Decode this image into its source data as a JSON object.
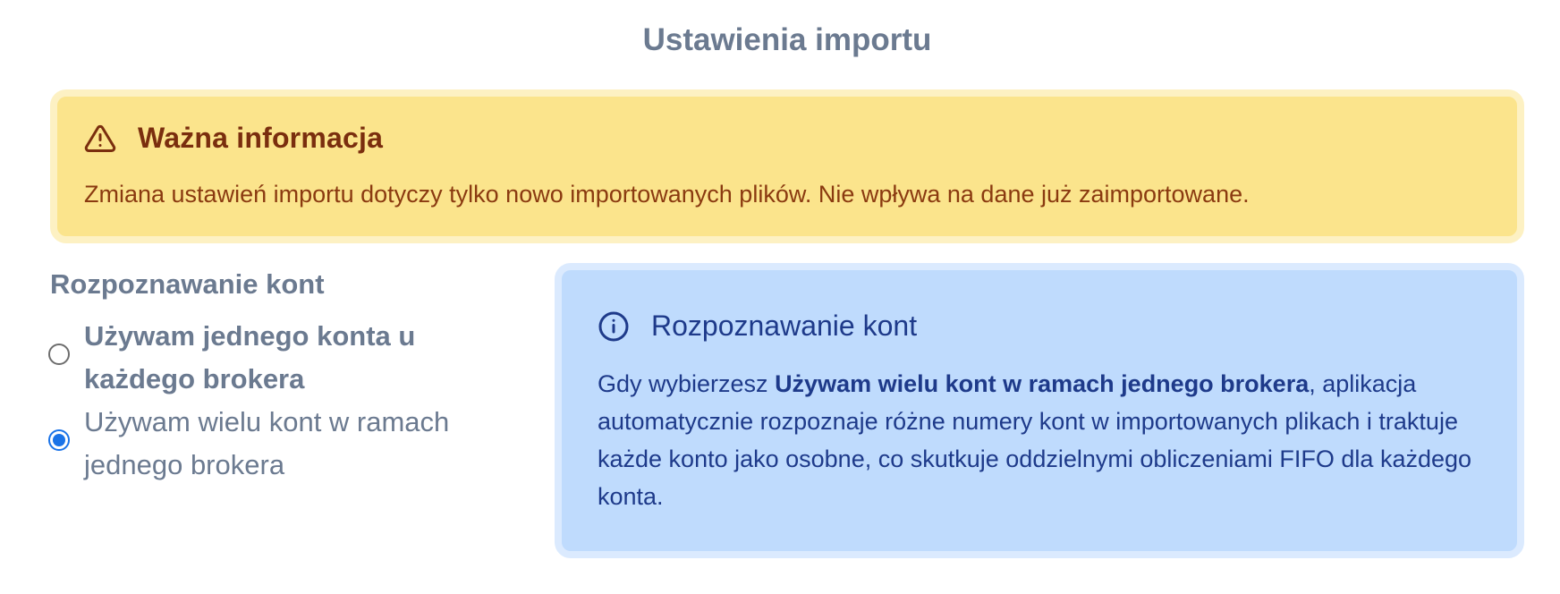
{
  "page": {
    "title": "Ustawienia importu"
  },
  "warning": {
    "icon": "warning-triangle-icon",
    "title": "Ważna informacja",
    "text": "Zmiana ustawień importu dotyczy tylko nowo importowanych plików. Nie wpływa na dane już zaimportowane.",
    "colors": {
      "background": "#fbe48c",
      "border": "#fdf1c3",
      "title": "#7a2e0e",
      "text": "#8a3a10"
    }
  },
  "account_recognition": {
    "label": "Rozpoznawanie kont",
    "selected_index": 1,
    "options": [
      {
        "label": "Używam jednego konta u każdego brokera",
        "selected": false
      },
      {
        "label": "Używam wielu kont w ramach jednego brokera",
        "selected": true
      }
    ],
    "accent_color": "#1a73e8"
  },
  "info": {
    "icon": "info-circle-icon",
    "title": "Rozpoznawanie kont",
    "text_before": "Gdy wybierzesz ",
    "text_bold": "Używam wielu kont w ramach jednego brokera",
    "text_after": ", aplikacja automatycznie rozpoznaje różne numery kont w importowanych plikach i traktuje każde konto jako osobne, co skutkuje oddzielnymi obliczeniami FIFO dla każdego konta.",
    "colors": {
      "background": "#bfdbfd",
      "border": "#dbeafe",
      "text": "#1e3a8a"
    }
  }
}
